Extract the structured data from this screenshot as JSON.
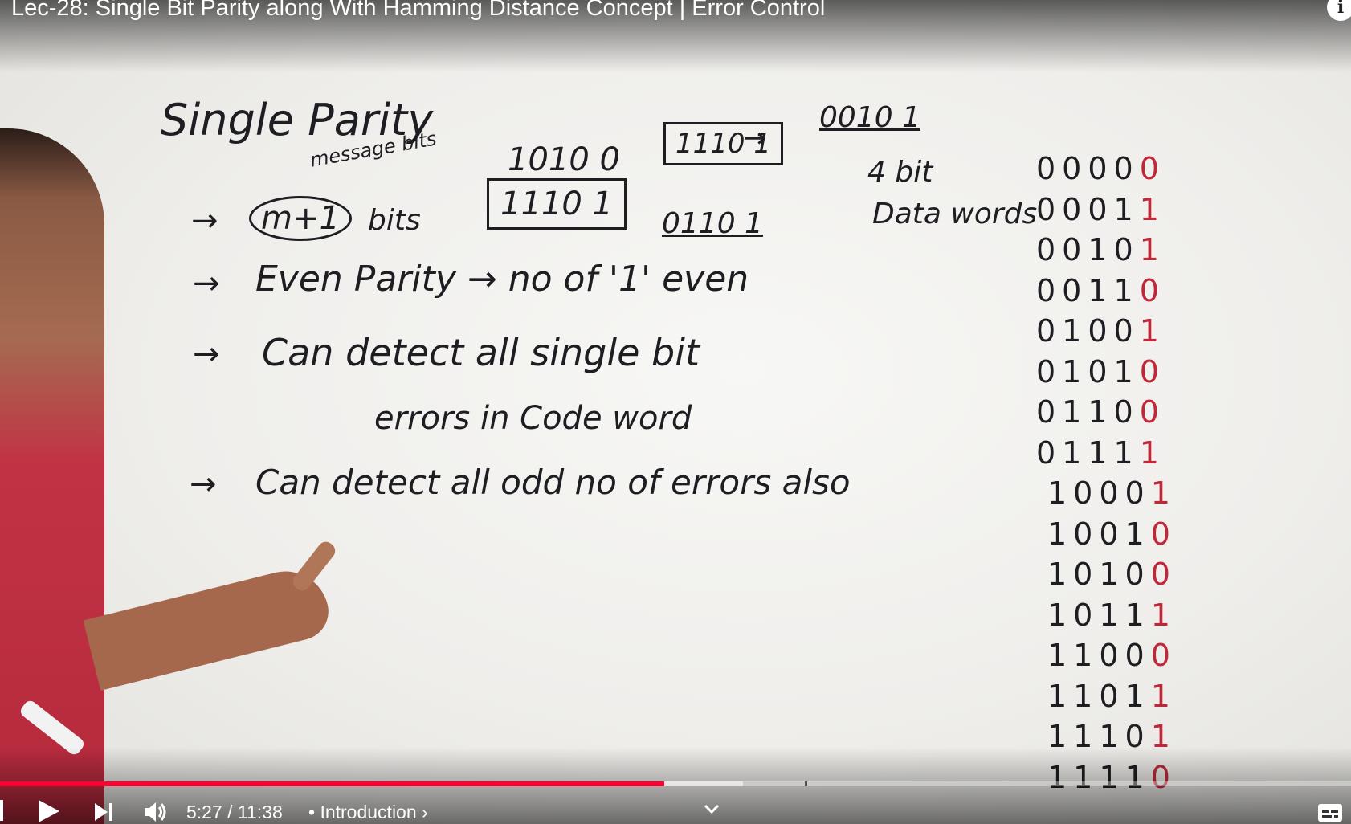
{
  "video": {
    "title": "Lec-28: Single Bit Parity along With Hamming Distance Concept | Error Control"
  },
  "board": {
    "heading": "Single Parity",
    "message_bits": "message bits",
    "m_plus_1": "m+1",
    "bits": "bits",
    "example_top": "1010 0",
    "example_box": "1110 1",
    "small_box": "1110 1",
    "arrow_result": "0010 1",
    "down_result": "0110 1",
    "four_bit": "4 bit",
    "data_words": "Data words",
    "line_even": "Even Parity → no of '1' even",
    "line_detect1": "Can detect all single bit",
    "line_detect2": "errors in Code word",
    "line_odd": "Can detect all odd no of errors also",
    "arrow": "→"
  },
  "table": {
    "data_words": [
      "0000",
      "0001",
      "0010",
      "0011",
      "0100",
      "0101",
      "0110",
      "0111",
      "1000",
      "1001",
      "1010",
      "1011",
      "1100",
      "1101",
      "1110",
      "1111"
    ],
    "parity": [
      "0",
      "1",
      "1",
      "0",
      "1",
      "0",
      "0",
      "1",
      "1",
      "0",
      "0",
      "1",
      "0",
      "1",
      "1",
      "0"
    ],
    "parity_color": "#c0283a"
  },
  "player": {
    "current_time": "5:27",
    "duration": "11:38",
    "time_text": "5:27 / 11:38",
    "chapter_label": "• Introduction ›",
    "progress_played": 0.4914,
    "progress_buffered": 0.55,
    "accent_color": "#ff0033",
    "icons": {
      "play": "play-icon",
      "next": "next-icon",
      "volume": "volume-icon",
      "captions": "captions-icon",
      "chevron": "chevron-down-icon",
      "info": "info-icon"
    }
  }
}
